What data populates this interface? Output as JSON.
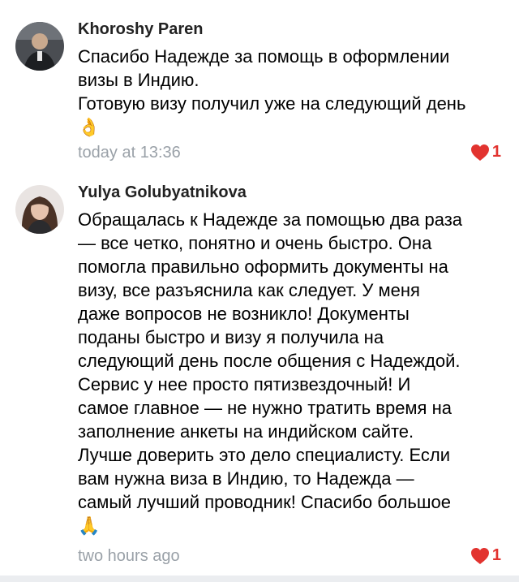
{
  "comments": [
    {
      "author": "Khoroshy Paren",
      "lines": [
        "Спасибо Надежде за помощь в оформлении",
        "визы в Индию.",
        "Готовую визу получил уже на следующий день"
      ],
      "emoji": "👌",
      "time": "today at 13:36",
      "likes": "1"
    },
    {
      "author": "Yulya Golubyatnikova",
      "lines": [
        "Обращалась к Надежде за помощью два раза",
        "— все четко, понятно и очень быстро. Она",
        "помогла правильно оформить документы на",
        "визу, все разъяснила как следует. У меня",
        "даже вопросов не возникло! Документы",
        "поданы быстро и визу я получила на",
        "следующий день после общения с Надеждой.",
        "Сервис у нее просто пятизвездочный! И",
        "самое главное — не нужно тратить время на",
        "заполнение анкеты на индийском сайте.",
        "Лучше доверить это дело специалисту. Если",
        "вам нужна виза в Индию, то Надежда —",
        "самый лучший проводник! Спасибо большое"
      ],
      "emoji": "🙏",
      "time": "two hours ago",
      "likes": "1"
    }
  ],
  "colors": {
    "like": "#e2332f",
    "meta": "#9aa1a8",
    "author": "#222222"
  },
  "icons": {
    "like": "heart-icon"
  }
}
